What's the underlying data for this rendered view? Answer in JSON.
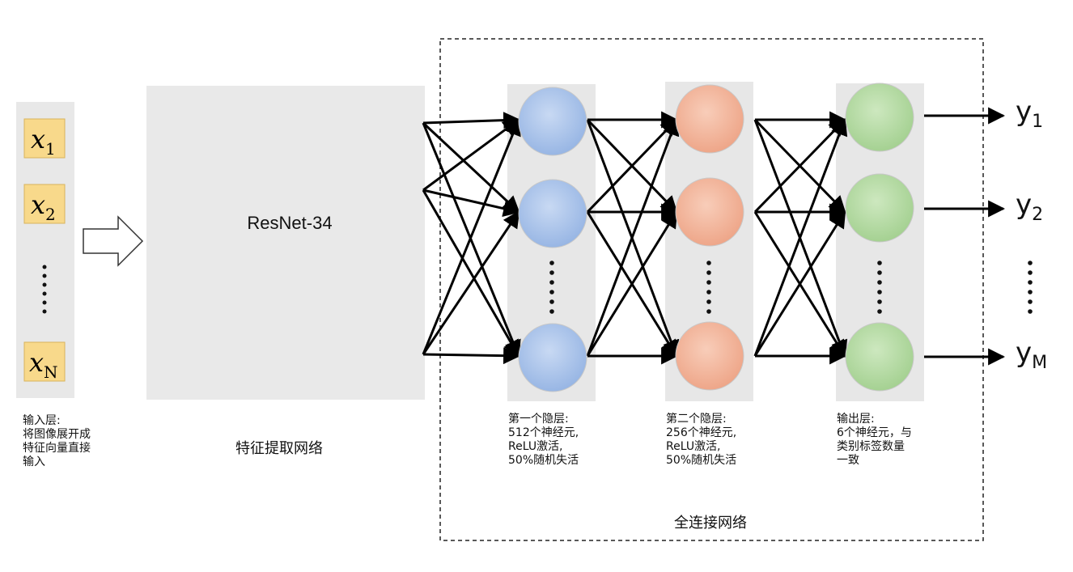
{
  "input": {
    "items": [
      "x",
      "x",
      "x"
    ],
    "subscripts": [
      "1",
      "2",
      "N"
    ],
    "caption": [
      "输入层:",
      "将图像展开成",
      "特征向量直接",
      "输入"
    ]
  },
  "feature": {
    "box_label": "ResNet-34",
    "caption": "特征提取网络"
  },
  "layers": [
    {
      "caption": [
        "第一个隐层:",
        "512个神经元,",
        "ReLU激活,",
        "50%随机失活"
      ]
    },
    {
      "caption": [
        "第二个隐层:",
        "256个神经元,",
        "ReLU激活,",
        "50%随机失活"
      ]
    },
    {
      "caption": [
        "输出层:",
        "6个神经元，与",
        "类别标签数量",
        "一致"
      ]
    }
  ],
  "fc_caption": "全连接网络",
  "outputs": {
    "base": [
      "y",
      "y",
      "y"
    ],
    "subscripts": [
      "1",
      "2",
      "M"
    ]
  },
  "colors": {
    "layer1": "#a9c4ea",
    "layer2": "#f2b8a0",
    "layer3": "#b8dba8",
    "column_bg": "#e7e7e7",
    "input_tile": "#f8d98b",
    "box": "#e9e9e9"
  }
}
